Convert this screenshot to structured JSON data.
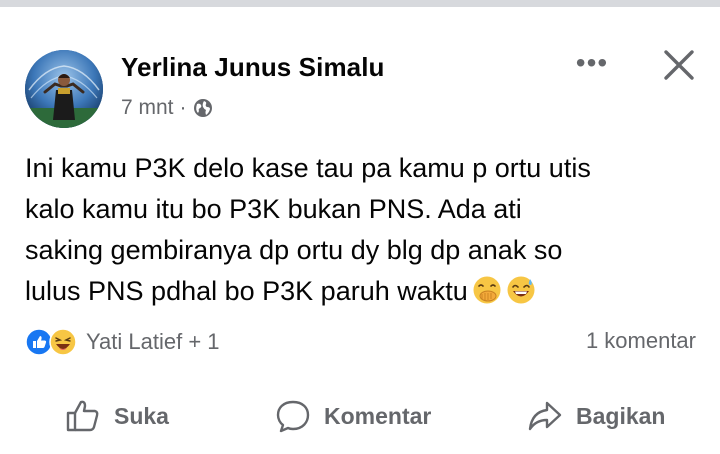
{
  "post": {
    "author": "Yerlina Junus Simalu",
    "time": "7 mnt",
    "separator": "·",
    "privacy_icon": "globe-icon",
    "more_icon": "more-dots-icon",
    "more_glyph": "•••",
    "close_icon": "close-icon",
    "text": "Ini kamu P3K delo kase tau pa kamu p ortu utis\nkalo kamu itu bo P3K bukan PNS. Ada ati\nsaking gembiranya dp ortu dy blg dp anak so\nlulus PNS pdhal bo P3K paruh waktu",
    "emojis": [
      "face-with-hand-over-mouth-icon",
      "grinning-sweat-icon"
    ]
  },
  "reactions": {
    "icons": [
      "like-reaction-icon",
      "haha-reaction-icon"
    ],
    "names": "Yati Latief + 1",
    "comments": "1 komentar"
  },
  "actions": {
    "like_label": "Suka",
    "comment_label": "Komentar",
    "share_label": "Bagikan"
  },
  "colors": {
    "text": "#050505",
    "secondary": "#65676b",
    "like_blue": "#1877f2",
    "haha_yellow": "#f7c644"
  }
}
